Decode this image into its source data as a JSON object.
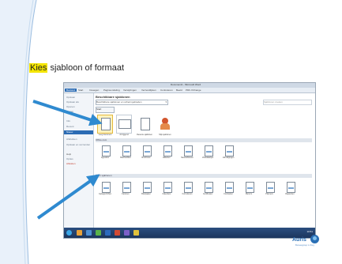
{
  "heading": {
    "highlight": "Kies",
    "rest": " sjabloon of formaat"
  },
  "app": {
    "window_title": "Document1 - Microsoft Word",
    "tabs": [
      "Bestand",
      "Start",
      "Invoegen",
      "Pagina-indeling",
      "Verwijzingen",
      "Verzendlijsten",
      "Controleren",
      "Beeld",
      "PDF-XChange"
    ],
    "backstage_items": [
      "Opslaan",
      "Opslaan als",
      "Openen",
      "Sluiten",
      "Info",
      "Recent",
      "Nieuw",
      "Afdrukken",
      "Opslaan en verzenden",
      "Help",
      "Opties",
      "Afsluiten"
    ],
    "selected_item": "Nieuw",
    "main_title": "Beschikbare sjablonen",
    "dropdown": "Beschikbare sjablonen en schermgebieden",
    "search_placeholder": "Sjablonen zoeken",
    "home_button": "Start",
    "templates": [
      "Leeg document",
      "A4 liggend",
      "Recente sjablonen",
      "Mijn sjablonen"
    ],
    "section_office": "Office.com",
    "office_items": [
      "Agenda's",
      "Briefhoofden",
      "Brochures",
      "Etiketten",
      "Nieuwsbrieven",
      "Visitekaartjes",
      "Uitnodigingen"
    ],
    "section_more": "Meer sjablonen",
    "more_items": [
      "Getuigschriften",
      "Facturen",
      "Briefpapier",
      "Kalenders",
      "Formulieren",
      "Certificaten",
      "Contracten",
      "Memo's",
      "Planners",
      "Rapporten"
    ],
    "clock": "10:51"
  },
  "logo": {
    "brand": "Auris",
    "tagline": "Bureaugroep in Zorg"
  },
  "colors": {
    "accent": "#2c6cb4",
    "highlight": "#f4e500",
    "arrow": "#2f8ad0"
  }
}
